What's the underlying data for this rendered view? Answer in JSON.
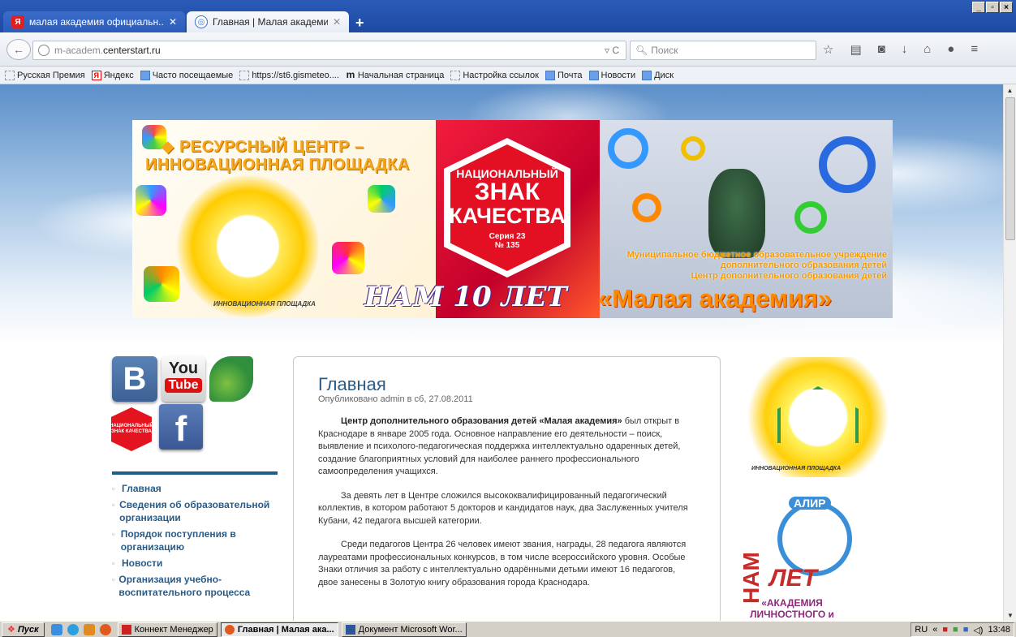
{
  "browser": {
    "tabs": [
      {
        "title": "малая академия официальн...",
        "favicon": "yandex-icon",
        "active": false
      },
      {
        "title": "Главная | Малая академия",
        "favicon": "site-icon",
        "active": true
      }
    ],
    "new_tab_label": "+",
    "window_controls": [
      "_",
      "▫",
      "×"
    ],
    "url_host_prefix": "m-academ.",
    "url_host_domain": "centerstart.ru",
    "search_placeholder": "Поиск",
    "bookmarks": [
      {
        "label": "Русская Премия",
        "icon": "folder-icon"
      },
      {
        "label": "Яндекс",
        "icon": "yandex-icon"
      },
      {
        "label": "Часто посещаемые",
        "icon": "star-folder-icon"
      },
      {
        "label": "https://st6.gismeteo....",
        "icon": "page-icon"
      },
      {
        "label": "Начальная страница",
        "icon": "m-icon"
      },
      {
        "label": "Настройка ссылок",
        "icon": "page-icon"
      },
      {
        "label": "Почта",
        "icon": "mail-icon"
      },
      {
        "label": "Новости",
        "icon": "news-icon"
      },
      {
        "label": "Диск",
        "icon": "disk-icon"
      }
    ]
  },
  "banner": {
    "title_line1": "◆ РЕСУРСНЫЙ ЦЕНТР –",
    "title_line2": "ИННОВАЦИОННАЯ ПЛОЩАДКА",
    "sun_caption": "ИННОВАЦИОННАЯ ПЛОЩАДКА",
    "badge_line1": "НАЦИОНАЛЬНЫЙ",
    "badge_line2": "ЗНАК",
    "badge_line3": "КАЧЕСТВА",
    "badge_series": "Серия 23",
    "badge_number": "№ 135",
    "anniversary": "НАМ 10 ЛЕТ",
    "institution_line1": "Муниципальное бюджетное образовательное учреждение",
    "institution_line2": "дополнительного образования детей",
    "institution_line3": "Центр дополнительного образования детей",
    "institution_name": "«Малая академия»"
  },
  "sidebar": {
    "social": {
      "vk": "B",
      "youtube_top": "You",
      "youtube_bottom": "Tube",
      "znak": "НАЦИОНАЛЬНЫЙ ЗНАК КАЧЕСТВА",
      "facebook": "f"
    },
    "menu": [
      "Главная",
      "Сведения об образовательной организации",
      "Порядок поступления в организацию",
      "Новости",
      "Организация учебно-воспитательного процесса"
    ]
  },
  "article": {
    "title": "Главная",
    "meta": "Опубликовано admin в сб, 27.08.2011",
    "p1_bold": "Центр дополнительного образования детей «Малая академия»",
    "p1_rest": " был открыт в Краснодаре в январе 2005 года. Основное направление его деятельности – поиск, выявление и психолого-педагогическая поддержка интеллектуально одаренных детей, создание благоприятных условий для наиболее раннего профессионального самоопределения учащихся.",
    "p2": "За девять лет в Центре сложился высококвалифицированный педагогический коллектив, в котором работают 5 докторов и кандидатов наук, два Заслуженных учителя Кубани, 42 педагога высшей категории.",
    "p3": "Среди педагогов Центра 26 человек имеют звания, награды, 28 педагога являются лауреатами профессиональных конкурсов, в том числе всероссийского уровня. Особые Знаки отличия за работу с интеллектуально одарёнными детьми имеют 16 педагогов, двое занесены в Золотую книгу образования города Краснодара."
  },
  "right_column": {
    "sun_caption": "ИННОВАЦИОННАЯ ПЛОЩАДКА",
    "alir_label": "АЛИР",
    "nam": "НАМ",
    "let": "ЛЕТ",
    "academy_text": "«АКАДЕМИЯ ЛИЧНОСТНОГО и ИНТЕЛЛЕКТУАЛЬНОГО РОСТА»"
  },
  "taskbar": {
    "start_label": "Пуск",
    "tasks": [
      {
        "label": "Коннект Менеджер",
        "active": false
      },
      {
        "label": "Главная | Малая ака...",
        "active": true
      },
      {
        "label": "Документ Microsoft Wor...",
        "active": false
      }
    ],
    "lang": "RU",
    "clock": "13:48"
  },
  "colors": {
    "link": "#2a5b86",
    "accent_bar": "#1e5d8c",
    "taskbar": "#d4d0c8"
  }
}
